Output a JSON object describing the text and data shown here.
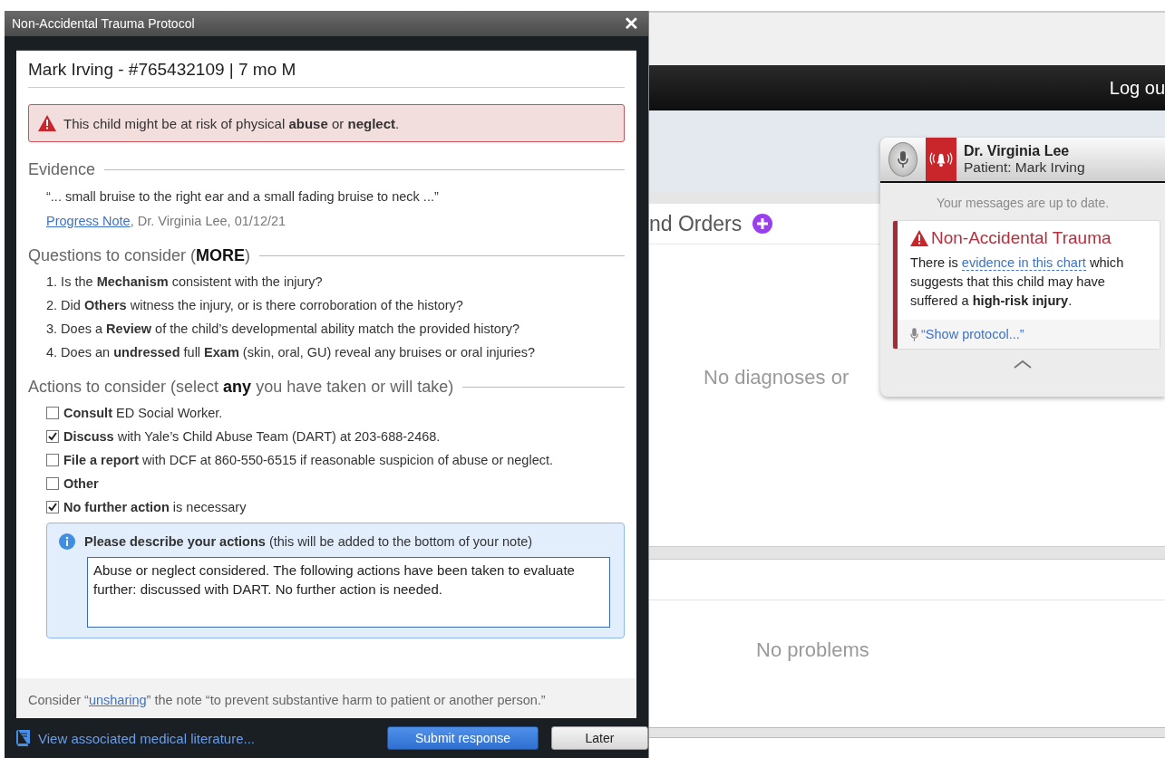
{
  "dialog": {
    "title": "Non-Accidental Trauma Protocol",
    "close": "✕",
    "patient_header": "Mark Irving - #765432109 | 7 mo M",
    "alert": "This child might be at risk of physical **abuse** or **neglect**.",
    "evidence": {
      "heading": "Evidence",
      "quote": "“... small bruise to the right ear and a small fading bruise to neck ...”",
      "source_link": "Progress Note",
      "source_rest": ", Dr. Virginia Lee, 01/12/21"
    },
    "questions": {
      "heading": "Questions to consider (**MORE**)",
      "items": [
        "1. Is the **Mechanism** consistent with the injury?",
        "2. Did **Others** witness the injury, or is there corroboration of the history?",
        "3. Does a **Review** of the child’s developmental ability match the provided history?",
        "4. Does an **undressed** full **Exam** (skin, oral, GU) reveal any bruises or oral injuries?"
      ]
    },
    "actions": {
      "heading": "Actions to consider (select **any** you have taken or will take)",
      "items": [
        {
          "label": "**Consult** ED Social Worker.",
          "checked": false
        },
        {
          "label": "**Discuss** with Yale’s Child Abuse Team (DART) at 203-688-2468.",
          "checked": true
        },
        {
          "label": "**File a report** with DCF at 860-550-6515 if reasonable suspicion of abuse or neglect.",
          "checked": false
        },
        {
          "label": "**Other**",
          "checked": false
        },
        {
          "label": "**No further action** is necessary",
          "checked": true
        }
      ]
    },
    "describe": {
      "prompt": "**Please describe your actions** (this will be added to the bottom of your note)",
      "value": "Abuse or neglect considered. The following actions have been taken to evaluate further: discussed with DART. No further action is needed. "
    },
    "sharing_note": {
      "before": "Consider “",
      "link": "unsharing",
      "after": "” the note “to prevent substantive harm to patient or another person.”"
    },
    "literature_link": "View associated medical literature...",
    "buttons": [
      {
        "label": "Submit response",
        "kind": "primary"
      },
      {
        "label": "Later",
        "kind": "secondary"
      }
    ]
  },
  "background": {
    "logout": "Log ou",
    "orders_heading": "nd Orders",
    "diagnoses_empty": "No diagnoses or",
    "problems_empty": "No problems"
  },
  "notification": {
    "doctor": "Dr. Virginia Lee",
    "patient": "Patient: Mark Irving",
    "status": "Your messages are up to date.",
    "alert_title": "Non-Accidental Trauma",
    "message_before": "There is ",
    "message_link": "evidence in this chart",
    "message_after": " which suggests that this child may have suffered a **high-risk injury**.",
    "voice_command": "“Show protocol...”"
  }
}
